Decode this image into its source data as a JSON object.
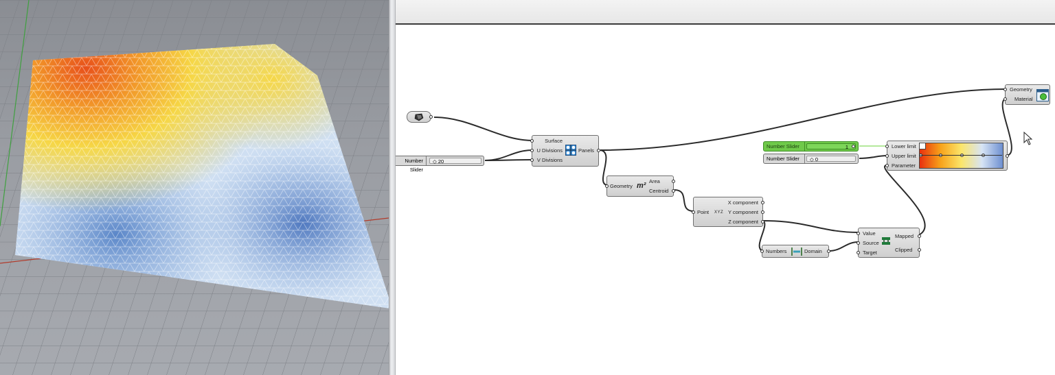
{
  "viewport": {
    "colors": {
      "peak": "#e8501a",
      "warm": "#f6d746",
      "neutral": "#f2f4f8",
      "cool": "#8fb1e0",
      "deep": "#5a86c8",
      "grid": "#7b7e84"
    }
  },
  "canvas": {
    "param_icon": "geometry-param-icon",
    "panels": {
      "inputs": [
        "Surface",
        "U Divisions",
        "V Divisions"
      ],
      "output": "Panels"
    },
    "slider_divisions": {
      "name": "Number Slider",
      "value": "20"
    },
    "area": {
      "input": "Geometry",
      "outputs": [
        "Area",
        "Centroid"
      ],
      "icon_text": "m²"
    },
    "deconstruct": {
      "input": "Point",
      "outputs": [
        "X component",
        "Y component",
        "Z component"
      ],
      "icon_text": "XYZ"
    },
    "bounds": {
      "input": "Numbers",
      "output": "Domain"
    },
    "remap": {
      "inputs": [
        "Value",
        "Source",
        "Target"
      ],
      "outputs": [
        "Mapped",
        "Clipped"
      ]
    },
    "slider_lower": {
      "name": "Number Slider",
      "value": "1"
    },
    "slider_upper": {
      "name": "Number Slider",
      "value": "0"
    },
    "gradient": {
      "inputs": [
        "Lower limit",
        "Upper limit",
        "Parameter"
      ],
      "colors": [
        "#e8300e",
        "#f7a21a",
        "#fbe56a",
        "#d7e4f5",
        "#6d8fd0"
      ]
    },
    "preview": {
      "inputs": [
        "Geometry",
        "Material"
      ]
    }
  }
}
